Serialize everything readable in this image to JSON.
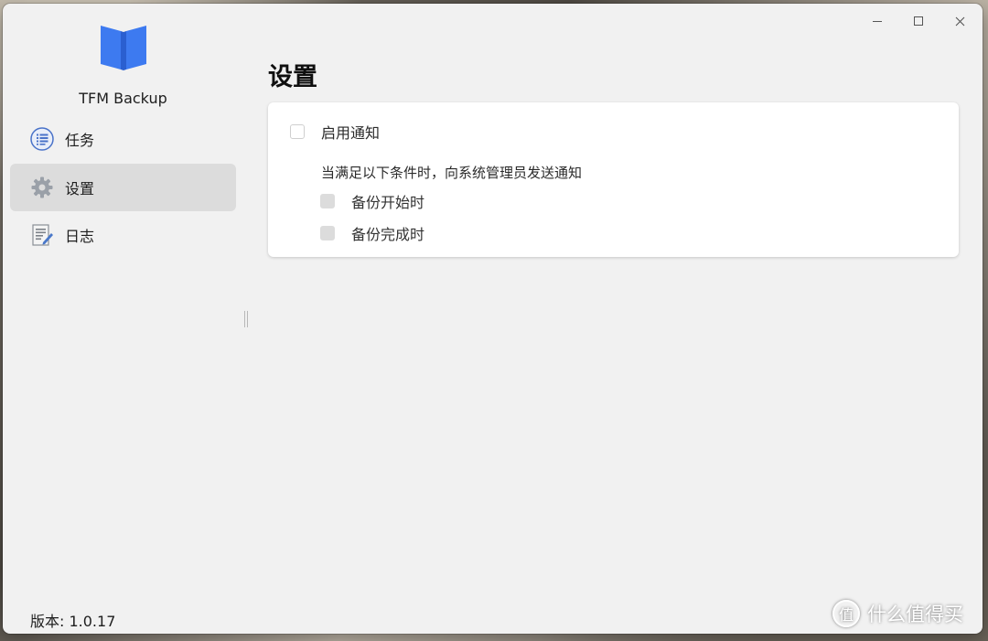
{
  "window": {
    "controls": [
      "minimize-icon",
      "maximize-icon",
      "close-icon"
    ]
  },
  "sidebar": {
    "app_name": "TFM Backup",
    "logo_color": "#3d7af0",
    "items": [
      {
        "label": "任务",
        "icon": "tasks-list-icon",
        "active": false
      },
      {
        "label": "设置",
        "icon": "gear-icon",
        "active": true
      },
      {
        "label": "日志",
        "icon": "log-document-icon",
        "active": false
      }
    ],
    "version": "版本: 1.0.17"
  },
  "main": {
    "title": "设置",
    "notification": {
      "enable_label": "启用通知",
      "enabled": false,
      "description": "当满足以下条件时，向系统管理员发送通知",
      "options": [
        {
          "label": "备份开始时",
          "checked": false,
          "disabled": true
        },
        {
          "label": "备份完成时",
          "checked": false,
          "disabled": true
        }
      ]
    }
  },
  "watermark": {
    "icon_text": "值",
    "text": "什么值得买"
  }
}
